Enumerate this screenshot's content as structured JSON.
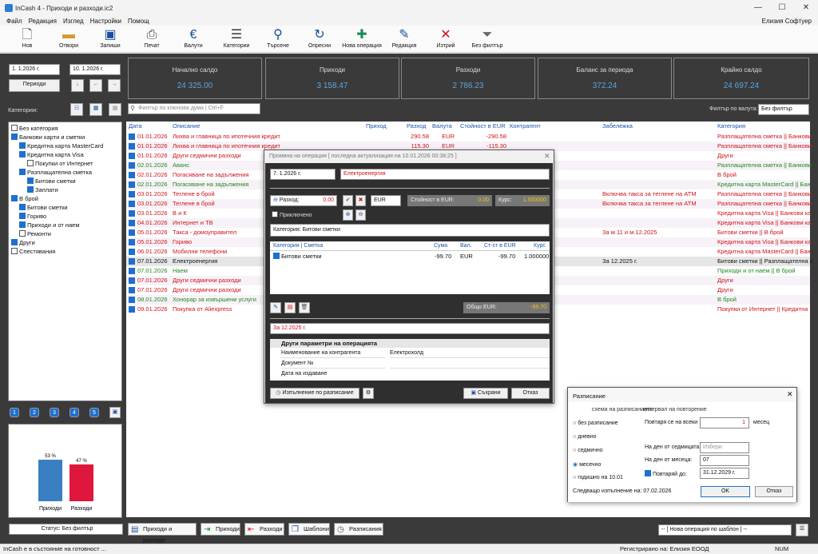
{
  "window": {
    "title": "InCash 4 - Приходи и разходи.ic2",
    "user": "Елизия Софтуер"
  },
  "menu": [
    "Файл",
    "Редакция",
    "Изглед",
    "Настройки",
    "Помощ"
  ],
  "toolbar": [
    {
      "label": "Нов",
      "icon": "new-file-icon"
    },
    {
      "label": "Отвори",
      "icon": "folder-icon"
    },
    {
      "label": "Запиши",
      "icon": "save-icon"
    },
    {
      "label": "Печат",
      "icon": "print-icon"
    },
    {
      "label": "Валути",
      "icon": "euro-icon"
    },
    {
      "label": "Категории",
      "icon": "categories-icon"
    },
    {
      "label": "Търсене",
      "icon": "search-icon"
    },
    {
      "label": "Опресни",
      "icon": "refresh-icon"
    },
    {
      "label": "Нова операция",
      "icon": "plus-icon"
    },
    {
      "label": "Редакция",
      "icon": "edit-icon"
    },
    {
      "label": "Изтрий",
      "icon": "delete-icon"
    },
    {
      "label": "Без филтър",
      "icon": "filter-off-icon"
    }
  ],
  "period": {
    "from": "1.  1.2026 г.",
    "to": "10.  1.2026 г.",
    "button": "Периоди"
  },
  "tiles": [
    {
      "label": "Начално салдо",
      "value": "24 325.00"
    },
    {
      "label": "Приходи",
      "value": "3 158.47"
    },
    {
      "label": "Разходи",
      "value": "2 786.23"
    },
    {
      "label": "Баланс за периода",
      "value": "372.24"
    },
    {
      "label": "Крайно салдо",
      "value": "24 697.24"
    }
  ],
  "categories_label": "Категории:",
  "filter_placeholder": "Филтър по ключова дума | Ctrl+F",
  "currency_filter": {
    "label": "Филтър по валута:",
    "value": "Без филтър"
  },
  "tree": [
    {
      "t": "Без категория",
      "l": 0,
      "c": false
    },
    {
      "t": "Банкови карти и сметки",
      "l": 0,
      "c": true
    },
    {
      "t": "Кредитна карта MasterCard",
      "l": 1,
      "c": true
    },
    {
      "t": "Кредитна карта Visa",
      "l": 1,
      "c": true
    },
    {
      "t": "Покупки от Интернет",
      "l": 2,
      "c": false
    },
    {
      "t": "Разплащателна сметка",
      "l": 1,
      "c": true
    },
    {
      "t": "Битови сметки",
      "l": 2,
      "c": true
    },
    {
      "t": "Заплати",
      "l": 2,
      "c": true
    },
    {
      "t": "В брой",
      "l": 0,
      "c": true
    },
    {
      "t": "Битови сметки",
      "l": 1,
      "c": true
    },
    {
      "t": "Гориво",
      "l": 1,
      "c": true
    },
    {
      "t": "Приходи и от наем",
      "l": 1,
      "c": true
    },
    {
      "t": "Ремонти",
      "l": 1,
      "c": false
    },
    {
      "t": "Други",
      "l": 0,
      "c": true
    },
    {
      "t": "Спестявания",
      "l": 0,
      "c": false
    }
  ],
  "columns": [
    "Дата",
    "Описание",
    "Приход",
    "Разход",
    "Валута",
    "Стойност в EUR",
    "Контрагент",
    "Забележка",
    "Категория"
  ],
  "rows": [
    {
      "d": "01.01.2026",
      "desc": "Лихва и главница по ипотечния кредит",
      "inc": "",
      "exp": "290.58",
      "cur": "EUR",
      "eur": "-290.58",
      "note": "",
      "cat": "Разплащателна сметка || Банкови",
      "k": "red"
    },
    {
      "d": "01.01.2026",
      "desc": "Лихва и главница по ипотечния кредит",
      "inc": "",
      "exp": "115.30",
      "cur": "EUR",
      "eur": "-115.30",
      "note": "",
      "cat": "Разплащателна сметка || Банкови",
      "k": "red"
    },
    {
      "d": "01.01.2026",
      "desc": "Други седмични разходи",
      "inc": "",
      "exp": "",
      "cur": "",
      "eur": "",
      "note": "",
      "cat": "Други",
      "k": "red"
    },
    {
      "d": "02.01.2026",
      "desc": "Аванс",
      "inc": "",
      "exp": "",
      "cur": "",
      "eur": "",
      "note": "",
      "cat": "Разплащателна сметка || Банкови",
      "k": "green"
    },
    {
      "d": "02.01.2026",
      "desc": "Погасяване на задължения",
      "inc": "",
      "exp": "",
      "cur": "",
      "eur": "",
      "note": "",
      "cat": "В брой",
      "k": "red"
    },
    {
      "d": "02.01.2026",
      "desc": "Погасяване на задължения",
      "inc": "",
      "exp": "",
      "cur": "",
      "eur": "",
      "note": "",
      "cat": "Кредитна карта MasterCard || Бан",
      "k": "green"
    },
    {
      "d": "03.01.2026",
      "desc": "Теглене в брой",
      "inc": "",
      "exp": "",
      "cur": "",
      "eur": "",
      "note": "Включва такса за теглене на ATM",
      "cat": "Разплащателна сметка || Банкови",
      "k": "red"
    },
    {
      "d": "03.01.2026",
      "desc": "Теглене в брой",
      "inc": "",
      "exp": "",
      "cur": "",
      "eur": "",
      "note": "Включва такса за теглене на ATM",
      "cat": "Разплащателна сметка || Банкови",
      "k": "red"
    },
    {
      "d": "03.01.2026",
      "desc": "В и К",
      "inc": "",
      "exp": "",
      "cur": "",
      "eur": "",
      "note": "",
      "cat": "Кредитна карта Visa || Банкови ка",
      "k": "red"
    },
    {
      "d": "04.01.2026",
      "desc": "Интернет и ТВ",
      "inc": "",
      "exp": "",
      "cur": "",
      "eur": "",
      "note": "",
      "cat": "Кредитна карта Visa || Банкови ка",
      "k": "red"
    },
    {
      "d": "05.01.2026",
      "desc": "Такса - домоуправител",
      "inc": "",
      "exp": "",
      "cur": "",
      "eur": "",
      "note": "За м.11 и м.12.2025",
      "cat": "Битови сметки || В брой",
      "k": "red"
    },
    {
      "d": "05.01.2026",
      "desc": "Гориво",
      "inc": "",
      "exp": "",
      "cur": "",
      "eur": "",
      "note": "",
      "cat": "Кредитна карта Visa || Банкови ка",
      "k": "red"
    },
    {
      "d": "06.01.2026",
      "desc": "Мобилни телефони",
      "inc": "",
      "exp": "",
      "cur": "",
      "eur": "",
      "note": "",
      "cat": "Кредитна карта MasterCard || Бан",
      "k": "red"
    },
    {
      "d": "07.01.2026",
      "desc": "Електроенергия",
      "inc": "",
      "exp": "",
      "cur": "",
      "eur": "",
      "note": "За 12.2025 г.",
      "cat": "Битови сметки || Разплащателна с",
      "k": "blk"
    },
    {
      "d": "07.01.2026",
      "desc": "Наем",
      "inc": "",
      "exp": "",
      "cur": "",
      "eur": "",
      "note": "",
      "cat": "Приходи и от наем || В брой",
      "k": "green"
    },
    {
      "d": "07.01.2026",
      "desc": "Други седмични разходи",
      "inc": "",
      "exp": "",
      "cur": "",
      "eur": "",
      "note": "",
      "cat": "Други",
      "k": "red"
    },
    {
      "d": "07.01.2026",
      "desc": "Други седмични разходи",
      "inc": "",
      "exp": "",
      "cur": "",
      "eur": "",
      "note": "",
      "cat": "Други",
      "k": "red"
    },
    {
      "d": "08.01.2026",
      "desc": "Хонорар за извършени услуги",
      "inc": "",
      "exp": "",
      "cur": "",
      "eur": "",
      "note": "",
      "cat": "В брой",
      "k": "green"
    },
    {
      "d": "09.01.2026",
      "desc": "Покупка от Aliexpress",
      "inc": "",
      "exp": "",
      "cur": "",
      "eur": "",
      "note": "",
      "cat": "Покупки от Интернет || Кредитна",
      "k": "red"
    }
  ],
  "chart_data": {
    "type": "bar",
    "categories": [
      "Приходи",
      "Разходи"
    ],
    "values": [
      53,
      47
    ],
    "value_labels": [
      "53 %",
      "47 %"
    ],
    "colors": [
      "#3a7fc1",
      "#e0173d"
    ],
    "ylim": [
      0,
      100
    ]
  },
  "page_buttons": [
    "1",
    "2",
    "3",
    "4",
    "5"
  ],
  "status_filter": "Статус: Без филтър",
  "tabs": [
    "Приходи и разходи",
    "Приходи",
    "Разходи",
    "Шаблони",
    "Разписания"
  ],
  "template_select": "-- [ Нова операция по шаблон ] --",
  "status": {
    "left": "InCash е в състояние на готовност ...",
    "registered": "Регистрирано на: Елизия ЕООД",
    "num": "NUM"
  },
  "op_dialog": {
    "title": "Промяна на операция [ последна актуализация на 10.01.2026 00:38:25 ]",
    "date": "7.   1.2026 г.",
    "desc": "Електроенергия",
    "exp_label": "Разход:",
    "exp_value": "0.00",
    "currency": "EUR",
    "eur_label": "Стойност в EUR:",
    "eur_value": "0.00",
    "rate_label": "Курс:",
    "rate_value": "1.000000",
    "attached": "Приключено",
    "category": "Категория: Битови сметки",
    "split_cols": [
      "Категория | Сметка",
      "Сума",
      "Вал.",
      "Ст-ст в EUR",
      "Курс"
    ],
    "split_row": {
      "cat": "Битови сметки",
      "sum": "-99.70",
      "cur": "EUR",
      "eur": "-99.70",
      "rate": "1.000000"
    },
    "total_label": "Общо EUR:",
    "total_value": "-99.70",
    "note": "За 12.2025 г.",
    "params_title": "Други параметри на операцията",
    "params": [
      {
        "k": "Наименование на контрагента",
        "v": "Електрохолд"
      },
      {
        "k": "Документ №",
        "v": ""
      },
      {
        "k": "Дата на издаване",
        "v": ""
      }
    ],
    "schedule_btn": "Изпълнение по разписание",
    "save_btn": "Съхрани",
    "cancel_btn": "Отказ"
  },
  "sched_dialog": {
    "title": "Разписание",
    "scheme_label": "схема на разписанието",
    "options": [
      "без разписание",
      "дневно",
      "седмично",
      "месечно",
      "годишно на 10.01"
    ],
    "interval_label": "интервал на повторение",
    "repeat_label": "Повтаря се на всеки",
    "repeat_value": "1",
    "repeat_unit": "месец",
    "weekday_label": "На ден от седмицата:",
    "weekday_value": "Избери",
    "monthday_label": "На ден от месеца:",
    "monthday_value": "07",
    "until_label": "Повтаряй до:",
    "until_value": "31.12.2029 г.",
    "next": "Следващо изпълнение на: 07.02.2026",
    "ok": "OK",
    "cancel": "Отказ"
  }
}
